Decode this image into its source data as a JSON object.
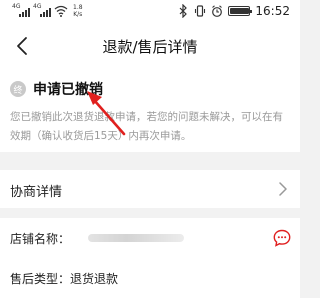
{
  "status_bar": {
    "network_1": "4G",
    "network_2": "4G",
    "speed_value": "1.8",
    "speed_unit": "K/s",
    "time": "16:52",
    "battery_level": 0.92
  },
  "header": {
    "title": "退款/售后详情"
  },
  "status_card": {
    "badge_text": "终",
    "title": "申请已撤销",
    "description": "您已撤销此次退货退款申请，若您的问题未解决，可以在有效期（确认收货后15天）内再次申请。"
  },
  "negotiation": {
    "label": "协商详情"
  },
  "store": {
    "label": "店铺名称："
  },
  "aftersale": {
    "label": "售后类型：退货退款"
  },
  "colors": {
    "arrow": "#e0201e",
    "chat_icon": "#e02020",
    "badge": "#c9c9c9"
  }
}
